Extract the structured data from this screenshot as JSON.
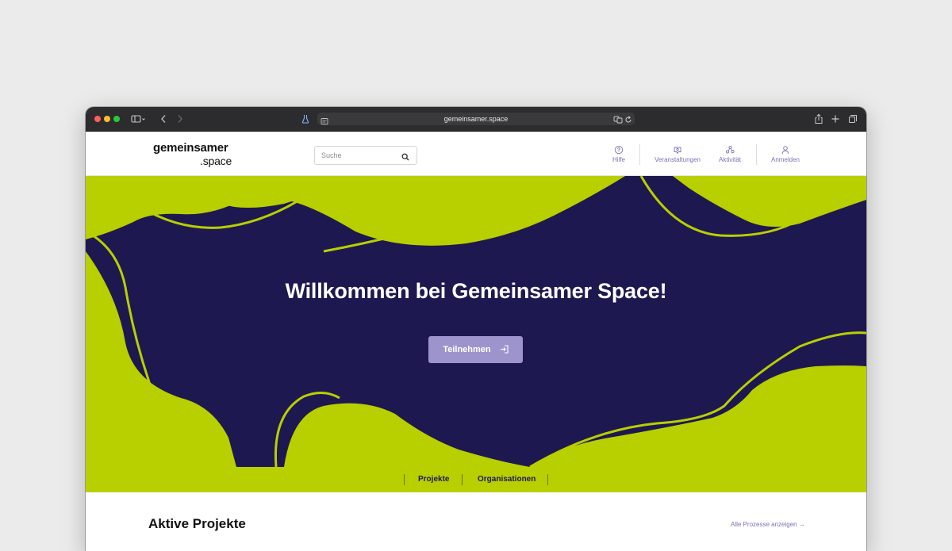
{
  "browser": {
    "url": "gemeinsamer.space",
    "colors": {
      "chrome": "#2c2c2e",
      "address_bar": "#3a3a3c"
    }
  },
  "header": {
    "logo_main": "gemeinsamer",
    "logo_sub": ".space",
    "search_placeholder": "Suche",
    "nav": [
      {
        "label": "Hilfe",
        "icon": "help-circle-icon"
      },
      {
        "label": "Veranstaltungen",
        "icon": "calendar-chat-icon"
      },
      {
        "label": "Aktivität",
        "icon": "activity-icon"
      },
      {
        "label": "Anmelden",
        "icon": "user-icon"
      }
    ]
  },
  "hero": {
    "title": "Willkommen bei Gemeinsamer Space!",
    "cta_label": "Teilnehmen",
    "cta_icon": "sign-in-icon",
    "colors": {
      "background": "#1e1850",
      "accent": "#b8cf00",
      "button": "#9d94cd"
    }
  },
  "subnav": {
    "items": [
      "Projekte",
      "Organisationen"
    ]
  },
  "main": {
    "section_title": "Aktive Projekte",
    "all_link": "Alle Prozesse anzeigen →"
  }
}
